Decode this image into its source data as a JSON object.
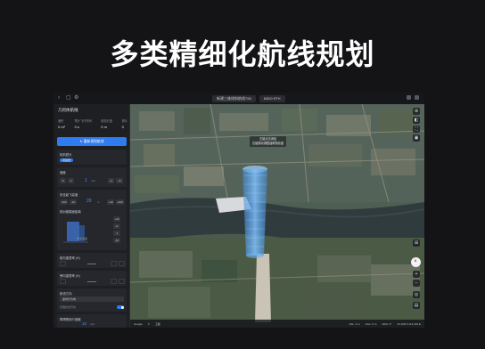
{
  "headline": "多类精细化航线规划",
  "topbar": {
    "file_name": "新建三维倾斜航线798",
    "device": "M300 RTK"
  },
  "panel": {
    "title": "几何体航线",
    "stats": [
      {
        "label": "面积",
        "value": "0 m²"
      },
      {
        "label": "预计飞行时间",
        "value": "0 s"
      },
      {
        "label": "航线长度",
        "value": "0 m"
      },
      {
        "label": "照片",
        "value": "0"
      }
    ],
    "plan_button": "↻ 重新规划航线",
    "sections": {
      "camera": {
        "title": "相机镜头",
        "pill": "可见光"
      },
      "speed": {
        "title": "速度",
        "buttons": [
          "-5",
          "-1",
          "+1",
          "+5"
        ],
        "value": "1",
        "unit": "m/s"
      },
      "altitude": {
        "title": "安全起飞高度",
        "buttons": [
          "-100",
          "-10",
          "+10",
          "+100"
        ],
        "value": "20",
        "unit": "m"
      },
      "model": {
        "title": "相对被摄面距离",
        "label": "参考地面",
        "side": [
          "+10",
          "+1",
          "-1",
          "-10"
        ]
      },
      "heading": {
        "title": "航向重叠率 (H)"
      },
      "side": {
        "title": "旁向重叠率 (H)"
      },
      "mode": {
        "title": "航线方向",
        "select": "逆时针方向",
        "toggle_label": "高程优化开关"
      },
      "limit": {
        "title": "障碍物绕行速度",
        "value": "10",
        "unit": "m/s"
      }
    }
  },
  "map": {
    "tooltip_line1": "左键点击添加",
    "tooltip_line2": "右键拖动调整建筑物高度",
    "controls": [
      "⊕",
      "◧",
      "⛶",
      "▣",
      "⊞"
    ],
    "bottom_controls": [
      "+",
      "−",
      "◎",
      "▤"
    ],
    "status": {
      "left": [
        "Google",
        "©",
        "卫星"
      ],
      "scale": "ASL: 0 m",
      "alt": "AGL: 0 m",
      "hdg": "HDG: 0°",
      "coords": "23.108 N 113.322 E"
    }
  }
}
